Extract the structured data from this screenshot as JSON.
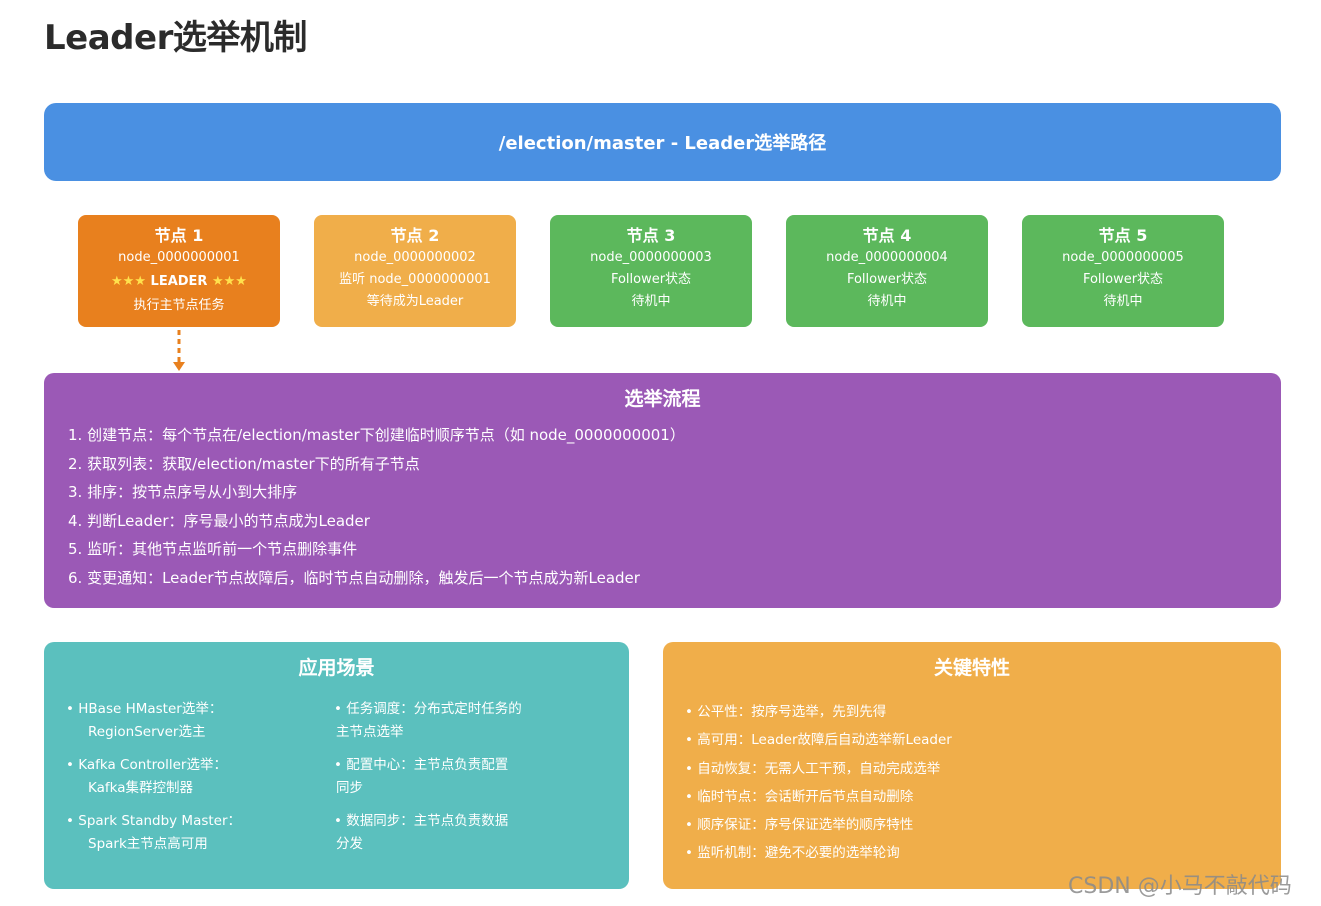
{
  "title": "Leader选举机制",
  "path_bar": "/election/master - Leader选举路径",
  "nodes": [
    {
      "title": "节点 1",
      "line1": "node_0000000001",
      "leader_stars": "★★★",
      "leader_label": "LEADER",
      "line3": "执行主节点任务"
    },
    {
      "title": "节点 2",
      "line1": "node_0000000002",
      "line2": "监听 node_0000000001",
      "line3": "等待成为Leader"
    },
    {
      "title": "节点 3",
      "line1": "node_0000000003",
      "line2": "Follower状态",
      "line3": "待机中"
    },
    {
      "title": "节点 4",
      "line1": "node_0000000004",
      "line2": "Follower状态",
      "line3": "待机中"
    },
    {
      "title": "节点 5",
      "line1": "node_0000000005",
      "line2": "Follower状态",
      "line3": "待机中"
    }
  ],
  "flow": {
    "title": "选举流程",
    "steps": [
      "1. 创建节点：每个节点在/election/master下创建临时顺序节点（如 node_0000000001）",
      "2. 获取列表：获取/election/master下的所有子节点",
      "3. 排序：按节点序号从小到大排序",
      "4. 判断Leader：序号最小的节点成为Leader",
      "5. 监听：其他节点监听前一个节点删除事件",
      "6. 变更通知：Leader节点故障后，临时节点自动删除，触发后一个节点成为新Leader"
    ]
  },
  "apps": {
    "title": "应用场景",
    "left": [
      {
        "l1": "• HBase HMaster选举：",
        "l2": "RegionServer选主"
      },
      {
        "l1": "• Kafka Controller选举：",
        "l2": "Kafka集群控制器"
      },
      {
        "l1": "• Spark Standby Master：",
        "l2": "Spark主节点高可用"
      }
    ],
    "right": [
      {
        "l1": "• 任务调度：分布式定时任务的",
        "l2": "主节点选举"
      },
      {
        "l1": "• 配置中心：主节点负责配置",
        "l2": "同步"
      },
      {
        "l1": "• 数据同步：主节点负责数据",
        "l2": "分发"
      }
    ]
  },
  "features": {
    "title": "关键特性",
    "items": [
      "• 公平性：按序号选举，先到先得",
      "• 高可用：Leader故障后自动选举新Leader",
      "• 自动恢复：无需人工干预，自动完成选举",
      "• 临时节点：会话断开后节点自动删除",
      "• 顺序保证：序号保证选举的顺序特性",
      "• 监听机制：避免不必要的选举轮询"
    ]
  },
  "watermark": "CSDN @小马不敲代码"
}
